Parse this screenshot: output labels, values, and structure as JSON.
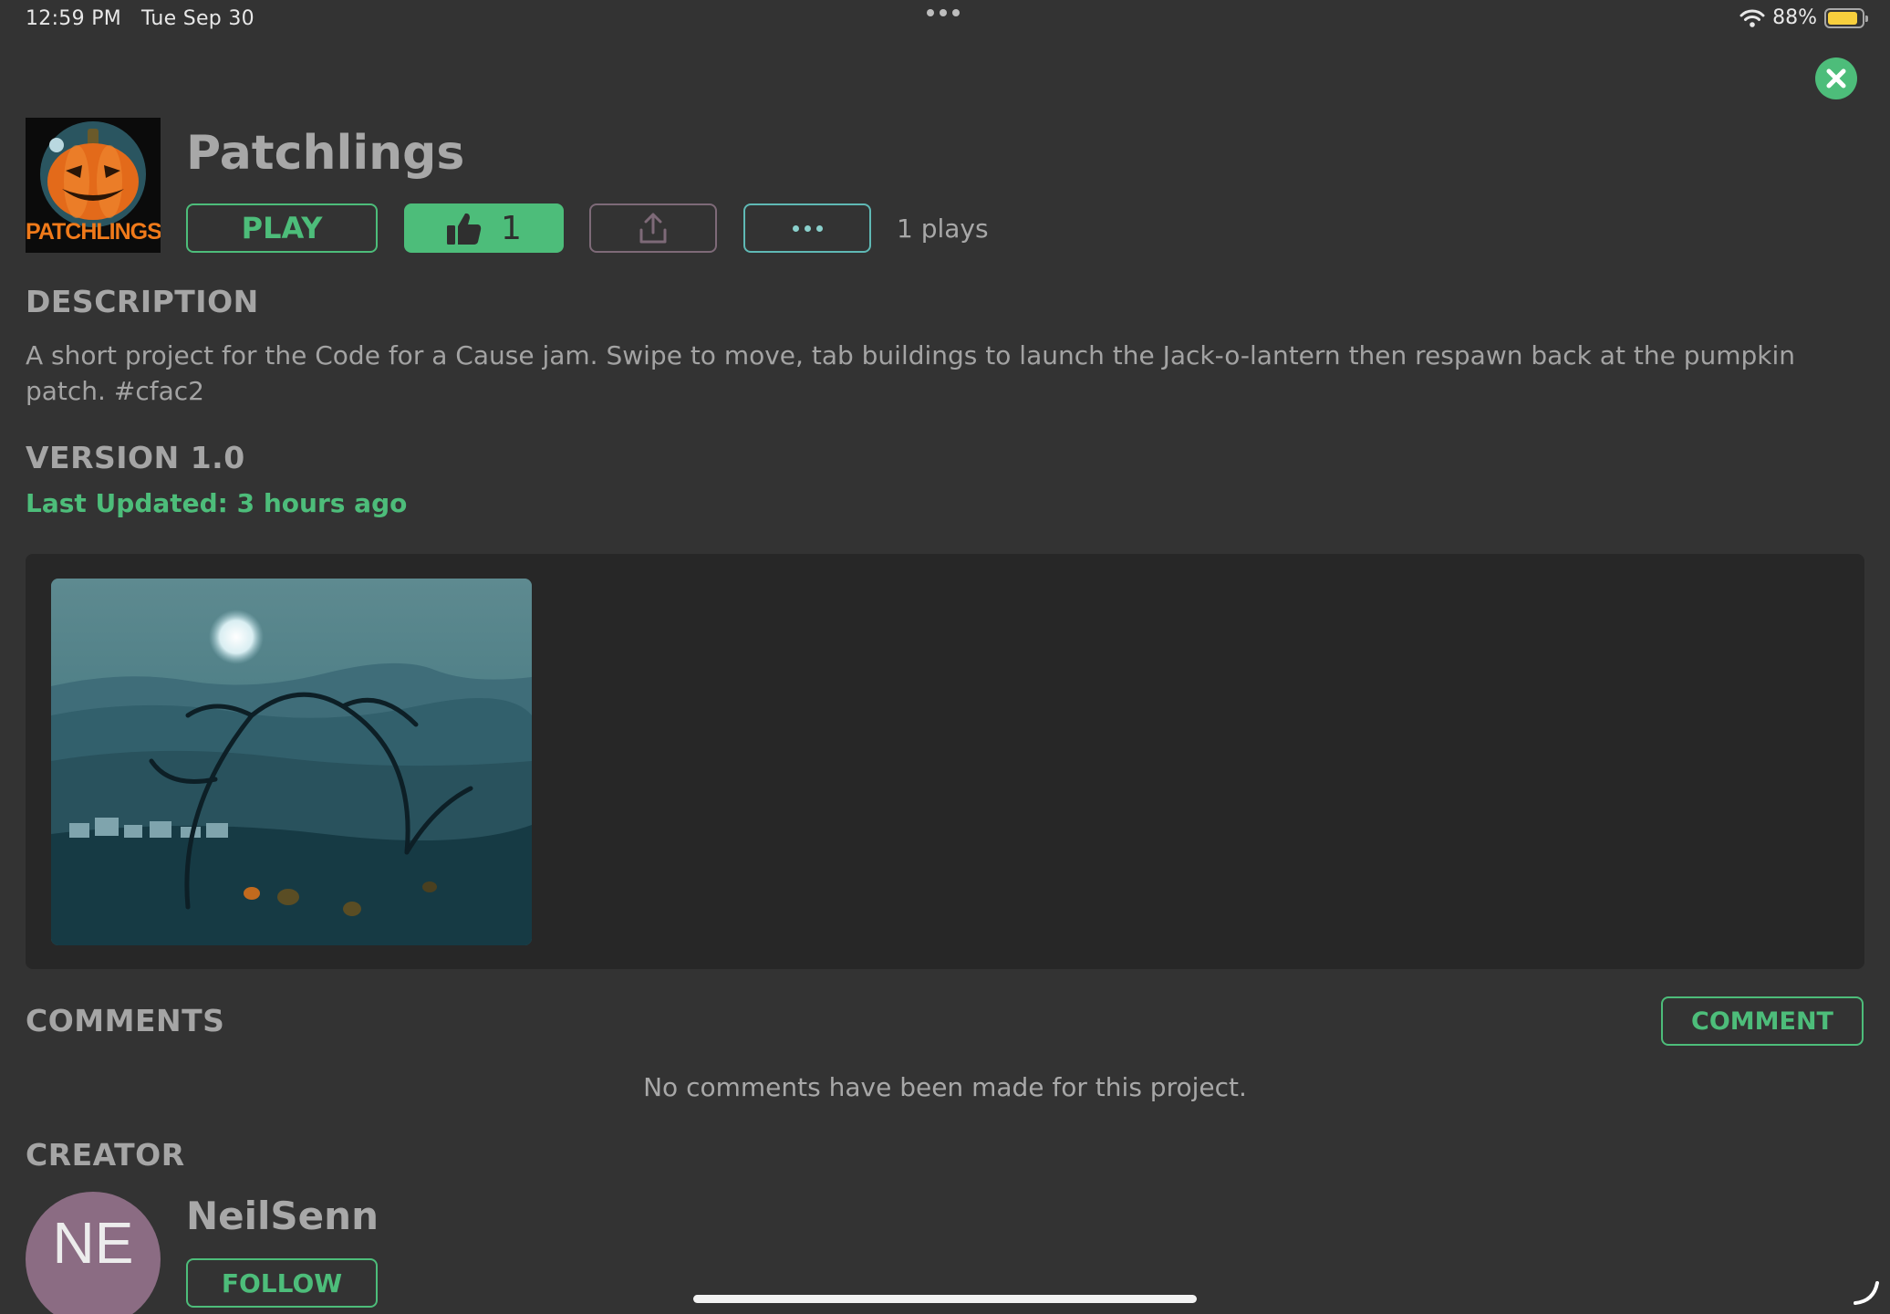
{
  "status_bar": {
    "time": "12:59 PM",
    "date": "Tue Sep 30",
    "battery": "88%",
    "battery_level": 0.88,
    "battery_color": "#f7cf3d"
  },
  "project": {
    "title": "Patchlings",
    "icon_text": "PATCHLINGS",
    "play_label": "PLAY",
    "likes": "1",
    "plays": "1 plays"
  },
  "description": {
    "heading": "DESCRIPTION",
    "text": " A short project for the Code for a Cause jam. Swipe to move, tab buildings to launch the Jack-o-lantern then respawn back at the pumpkin patch. #cfac2"
  },
  "version": {
    "heading": "VERSION 1.0",
    "last_updated": "Last Updated: 3 hours ago"
  },
  "comments": {
    "heading": "COMMENTS",
    "button_label": "COMMENT",
    "empty_message": "No comments have been made for this project."
  },
  "creator": {
    "heading": "CREATOR",
    "initials": "NE",
    "name": "NeilSenn",
    "follow_label": "FOLLOW"
  },
  "icons": [
    "close-icon",
    "thumbs-up-icon",
    "share-icon",
    "more-icon",
    "wifi-icon",
    "battery-icon"
  ],
  "colors": {
    "accent": "#4dbd7a",
    "background": "#333333",
    "panel": "#272727",
    "avatar": "#8b6c83"
  }
}
